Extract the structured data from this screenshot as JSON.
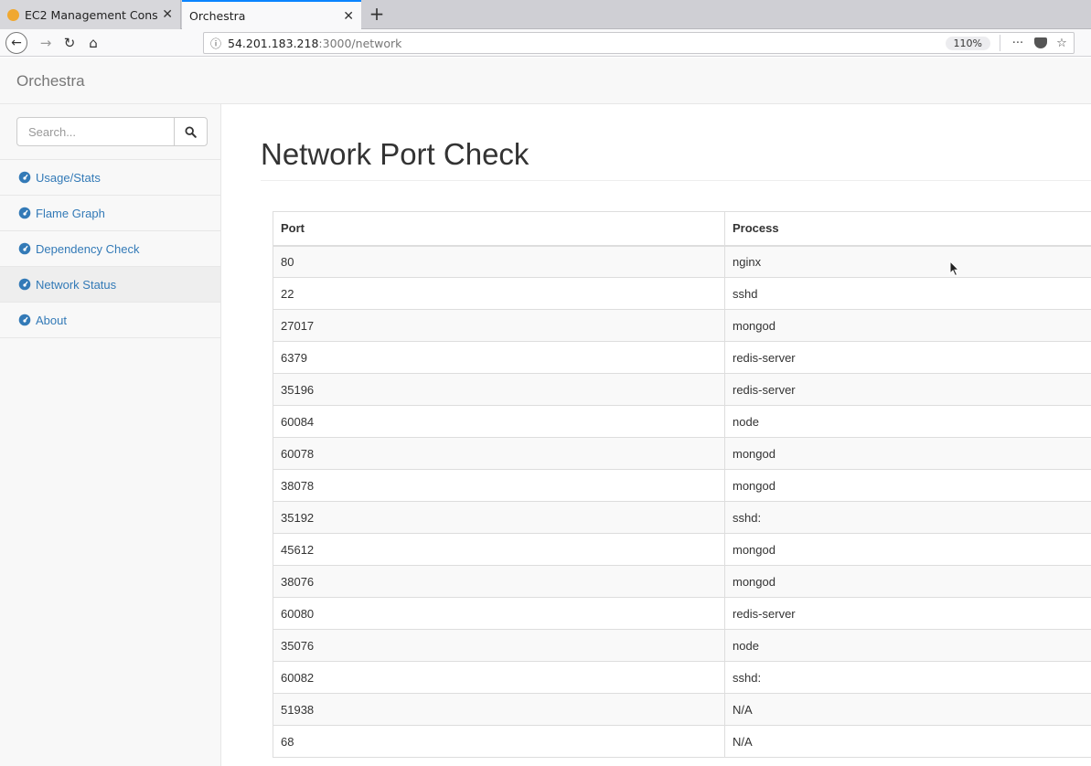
{
  "browser": {
    "tabs": [
      {
        "title": "EC2 Management Cons",
        "active": false
      },
      {
        "title": "Orchestra",
        "active": true
      }
    ],
    "url_host": "54.201.183.218",
    "url_rest": ":3000/network",
    "zoom": "110%",
    "overflow_label": "···"
  },
  "app": {
    "brand": "Orchestra",
    "search_placeholder": "Search...",
    "nav": [
      {
        "label": "Usage/Stats",
        "active": false
      },
      {
        "label": "Flame Graph",
        "active": false
      },
      {
        "label": "Dependency Check",
        "active": false
      },
      {
        "label": "Network Status",
        "active": true
      },
      {
        "label": "About",
        "active": false
      }
    ]
  },
  "page": {
    "title": "Network Port Check",
    "columns": [
      "Port",
      "Process"
    ],
    "rows": [
      [
        "80",
        "nginx"
      ],
      [
        "22",
        "sshd"
      ],
      [
        "27017",
        "mongod"
      ],
      [
        "6379",
        "redis-server"
      ],
      [
        "35196",
        "redis-server"
      ],
      [
        "60084",
        "node"
      ],
      [
        "60078",
        "mongod"
      ],
      [
        "38078",
        "mongod"
      ],
      [
        "35192",
        "sshd:"
      ],
      [
        "45612",
        "mongod"
      ],
      [
        "38076",
        "mongod"
      ],
      [
        "60080",
        "redis-server"
      ],
      [
        "35076",
        "node"
      ],
      [
        "60082",
        "sshd:"
      ],
      [
        "51938",
        "N/A"
      ],
      [
        "68",
        "N/A"
      ]
    ]
  },
  "colors": {
    "link": "#337ab7",
    "active_tab_accent": "#0a84ff",
    "favicon": "#f0a830"
  }
}
